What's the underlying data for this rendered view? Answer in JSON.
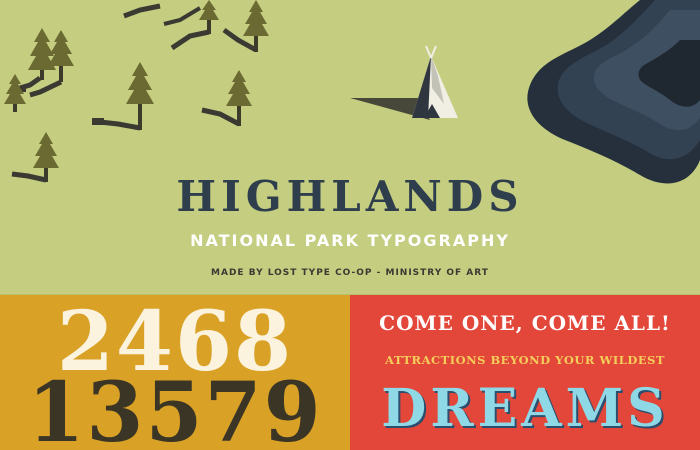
{
  "hero": {
    "title": "HIGHLANDS",
    "subtitle": "NATIONAL PARK TYPOGRAPHY",
    "credit": "MADE BY LOST TYPE CO-OP - MINISTRY OF ART"
  },
  "numerals": {
    "top": "2468",
    "bottom": "13579"
  },
  "poster": {
    "line1": "COME ONE, COME ALL!",
    "line2": "ATTRACTIONS BEYOND YOUR WILDEST",
    "line3": "DREAMS"
  },
  "colors": {
    "meadow": "#c4cd80",
    "navy": "#2f3e4d",
    "mustard": "#d9a226",
    "red": "#e3473a",
    "sky_blue": "#8fd8e6",
    "yellow": "#f4ce5a",
    "tree_green": "#6b6a32",
    "lake_dark": "#2f3a48"
  },
  "icons": [
    "pine-tree-icon",
    "teepee-icon",
    "lake-shape",
    "tree-shadow"
  ]
}
